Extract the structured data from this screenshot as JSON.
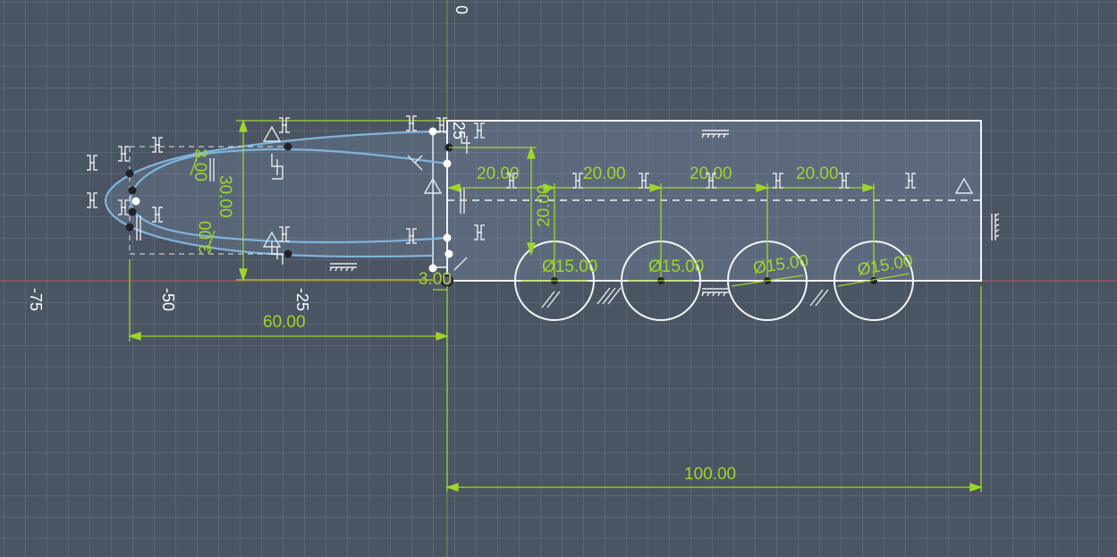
{
  "axis_labels": {
    "y_top": "0",
    "x_minus75": "-75",
    "x_minus50": "-50",
    "x_minus25": "-25"
  },
  "dimensions": {
    "width_overall": "100.00",
    "slot_length": "60.00",
    "slot_height": "30.00",
    "slot_offset_a": "3.00",
    "slot_offset_b": "3.00",
    "slot_gap": "3.00",
    "height_25": "25",
    "spacing_1": "20.00",
    "spacing_2": "20.00",
    "spacing_3": "20.00",
    "spacing_4": "20.00",
    "vertical_20": "20.00",
    "hole_1": "Ø15.00",
    "hole_2": "Ø15.00",
    "hole_3": "Ø15.00",
    "hole_4": "Ø15.00"
  },
  "colors": {
    "background": "#4b5463",
    "dimension": "#9ed62a",
    "sketch_line": "#f2f4f7",
    "slot_curve": "#7fb4dc",
    "profile_fill": "#8aa3bf",
    "x_axis": "#c0504d"
  }
}
